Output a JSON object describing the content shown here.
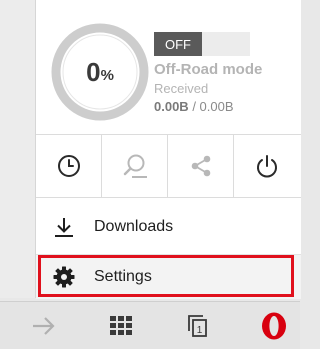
{
  "data_saver": {
    "percent": "0",
    "percent_sign": "%",
    "toggle_label": "OFF",
    "mode_title": "Off-Road mode",
    "received_label": "Received",
    "received_amount": "0.00B",
    "received_total": "0.00B"
  },
  "quick_actions": [
    {
      "name": "history-icon"
    },
    {
      "name": "find-in-page-icon"
    },
    {
      "name": "share-icon"
    },
    {
      "name": "power-exit-icon"
    }
  ],
  "menu": {
    "downloads_label": "Downloads",
    "settings_label": "Settings"
  },
  "toolbar": {
    "tab_count": "1"
  },
  "colors": {
    "highlight": "#e0101c",
    "opera_red": "#d8000f",
    "toggle_off_bg": "#5a5a5a"
  }
}
